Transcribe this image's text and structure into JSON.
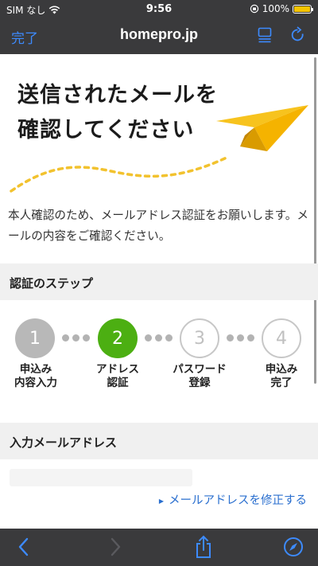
{
  "status_bar": {
    "carrier": "SIM なし",
    "time": "9:56",
    "battery": "100%"
  },
  "browser": {
    "done_label": "完了",
    "host": "homepro.jp"
  },
  "page": {
    "headline_line1": "送信されたメールを",
    "headline_line2": "確認してください",
    "intro": "本人確認のため、メールアドレス認証をお願いします。メールの内容をご確認ください。",
    "steps_title": "認証のステップ",
    "steps": [
      {
        "number": "1",
        "label": "申込み\n内容入力",
        "state": "done"
      },
      {
        "number": "2",
        "label": "アドレス\n認証",
        "state": "active"
      },
      {
        "number": "3",
        "label": "パスワード\n登録",
        "state": "todo"
      },
      {
        "number": "4",
        "label": "申込み\n完了",
        "state": "todo"
      }
    ],
    "email_title": "入力メールアドレス",
    "fix_link": "メールアドレスを修正する"
  },
  "colors": {
    "accent": "#3d8bff",
    "step_active": "#4caf12",
    "plane": "#f5b800",
    "link": "#2a6fcf"
  }
}
